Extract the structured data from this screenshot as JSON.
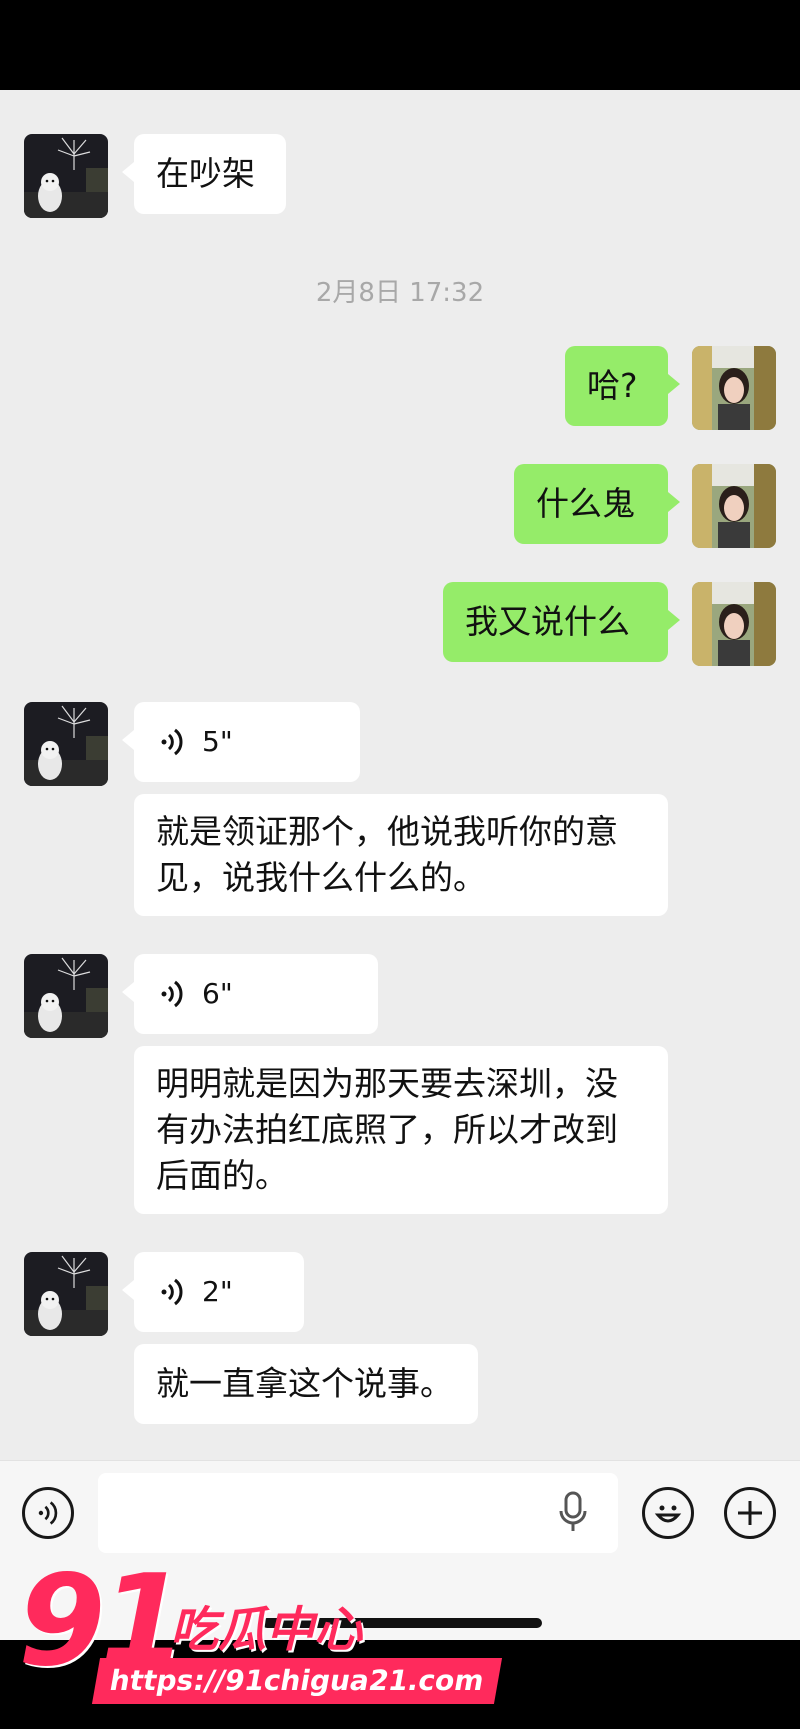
{
  "timestamp": "2月8日 17:32",
  "messages": {
    "m1": "在吵架",
    "m2": "哈?",
    "m3": "什么鬼",
    "m4": "我又说什么",
    "v1": "5\"",
    "m5": "就是领证那个，他说我听你的意见，说我什么什么的。",
    "v2": "6\"",
    "m6": "明明就是因为那天要去深圳，没有办法拍红底照了，所以才改到后面的。",
    "v3": "2\"",
    "m7": "就一直拿这个说事。"
  },
  "watermark": {
    "logo": "91",
    "name": "吃瓜中心",
    "url": "https://91chigua21.com"
  },
  "icons": {
    "voice_toggle": "voice-icon",
    "microphone": "mic-icon",
    "emoji": "emoji-icon",
    "more": "plus-icon"
  },
  "colors": {
    "background": "#ededed",
    "incoming_bubble": "#ffffff",
    "outgoing_bubble": "#95ec69",
    "watermark": "#ff2a5c"
  }
}
